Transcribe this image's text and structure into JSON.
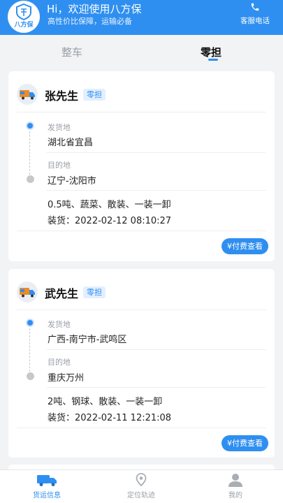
{
  "header": {
    "logo_text": "八方保",
    "welcome": "Hi，欢迎使用八方保",
    "tagline": "高性价比保障，运输必备",
    "service_label": "客服电话"
  },
  "tabs": [
    {
      "label": "整车",
      "active": false
    },
    {
      "label": "零担",
      "active": true
    }
  ],
  "orders": [
    {
      "name": "张先生",
      "tag": "零担",
      "origin_label": "发货地",
      "origin": "湖北省宜昌",
      "dest_label": "目的地",
      "dest": "辽宁-沈阳市",
      "cargo": "0.5吨、蔬菜、散装、一装一卸",
      "loading": "装货：2022-02-12 08:10:27",
      "button": "¥付费查看"
    },
    {
      "name": "武先生",
      "tag": "零担",
      "origin_label": "发货地",
      "origin": "广西-南宁市-武鸣区",
      "dest_label": "目的地",
      "dest": "重庆万州",
      "cargo": "2吨、钢球、散装、一装一卸",
      "loading": "装货：2022-02-11 12:21:08",
      "button": "¥付费查看"
    }
  ],
  "nav": [
    {
      "label": "货运信息",
      "icon": "truck-icon",
      "active": true
    },
    {
      "label": "定位轨迹",
      "icon": "location-icon",
      "active": false
    },
    {
      "label": "我的",
      "icon": "user-icon",
      "active": false
    }
  ],
  "colors": {
    "primary": "#2f8ff0",
    "background": "#f2f3f5",
    "muted": "#9aa0a8"
  }
}
